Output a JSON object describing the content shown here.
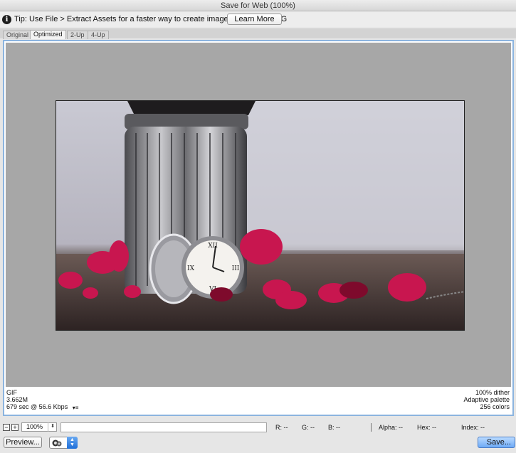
{
  "window": {
    "title": "Save for Web (100%)"
  },
  "tip": {
    "icon": "info-icon",
    "text": "Tip: Use File > Extract Assets for a faster way to create image assets and SVG",
    "learn_more": "Learn More"
  },
  "tabs": [
    {
      "label": "Original",
      "active": false
    },
    {
      "label": "Optimized",
      "active": true
    },
    {
      "label": "2-Up",
      "active": false
    },
    {
      "label": "4-Up",
      "active": false
    }
  ],
  "image_info": {
    "format": "GIF",
    "size": "3.662M",
    "download_time": "679 sec @ 56.6 Kbps",
    "dither": "100% dither",
    "palette": "Adaptive palette",
    "colors": "256 colors"
  },
  "status": {
    "zoom": "100%",
    "r_label": "R:",
    "r_value": "--",
    "g_label": "G:",
    "g_value": "--",
    "b_label": "B:",
    "b_value": "--",
    "alpha_label": "Alpha:",
    "alpha_value": "--",
    "hex_label": "Hex:",
    "hex_value": "--",
    "index_label": "Index:",
    "index_value": "--"
  },
  "bottom": {
    "preview_label": "Preview...",
    "save_label": "Save..."
  },
  "colors": {
    "accent": "#8cb4df",
    "canvas_gray": "#a7a7a7",
    "save_button": "#6eaaf6"
  }
}
